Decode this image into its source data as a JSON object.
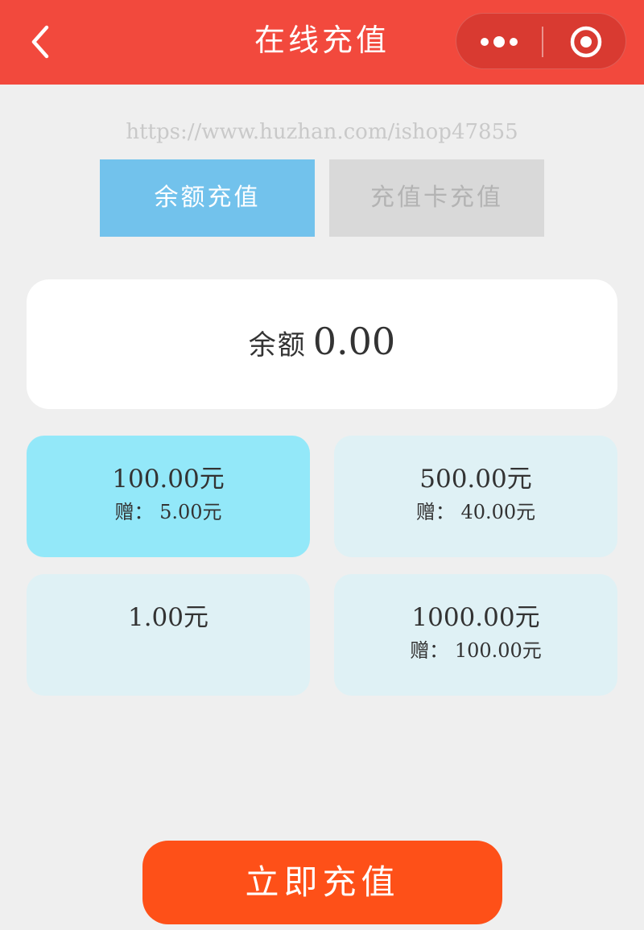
{
  "nav": {
    "title": "在线充值",
    "back_icon": "chevron-left-icon",
    "more_icon": "more-dots-icon",
    "close_icon": "target-circle-icon",
    "color": "#f2493d"
  },
  "watermark": "https://www.huzhan.com/ishop47855",
  "tabs": [
    {
      "label": "余额充值",
      "active": true
    },
    {
      "label": "充值卡充值",
      "active": false
    }
  ],
  "balance": {
    "label": "余额",
    "value": "0.00"
  },
  "options": [
    {
      "amount": "100.00元",
      "bonus": "赠： 5.00元",
      "selected": true
    },
    {
      "amount": "500.00元",
      "bonus": "赠： 40.00元",
      "selected": false
    },
    {
      "amount": "1.00元",
      "bonus": "",
      "selected": false
    },
    {
      "amount": "1000.00元",
      "bonus": "赠： 100.00元",
      "selected": false
    }
  ],
  "submit": {
    "label": "立即充值",
    "color": "#fe5018"
  }
}
